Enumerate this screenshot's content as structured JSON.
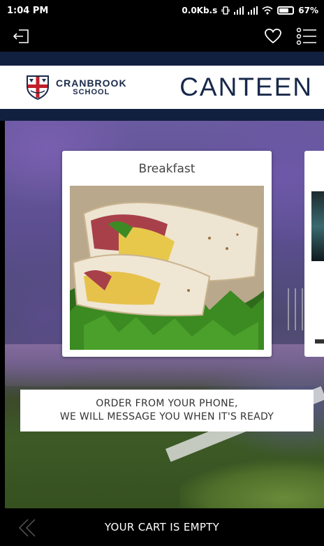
{
  "status_bar": {
    "time": "1:04 PM",
    "network_speed": "0.0Kb.s",
    "battery": "67%"
  },
  "app_bar": {
    "icons": [
      "logout-icon",
      "heart-icon",
      "menu-list-icon"
    ]
  },
  "banner": {
    "school_line1": "CRANBROOK",
    "school_line2": "SCHOOL",
    "title": "CANTEEN"
  },
  "menu_cards": [
    {
      "title": "Breakfast"
    }
  ],
  "info": {
    "line1": "ORDER FROM YOUR PHONE,",
    "line2": "WE WILL MESSAGE YOU WHEN IT'S READY"
  },
  "cart": {
    "status": "YOUR CART IS EMPTY"
  },
  "colors": {
    "navy": "#122040",
    "title": "#17284a",
    "crest_red": "#c0202a"
  }
}
